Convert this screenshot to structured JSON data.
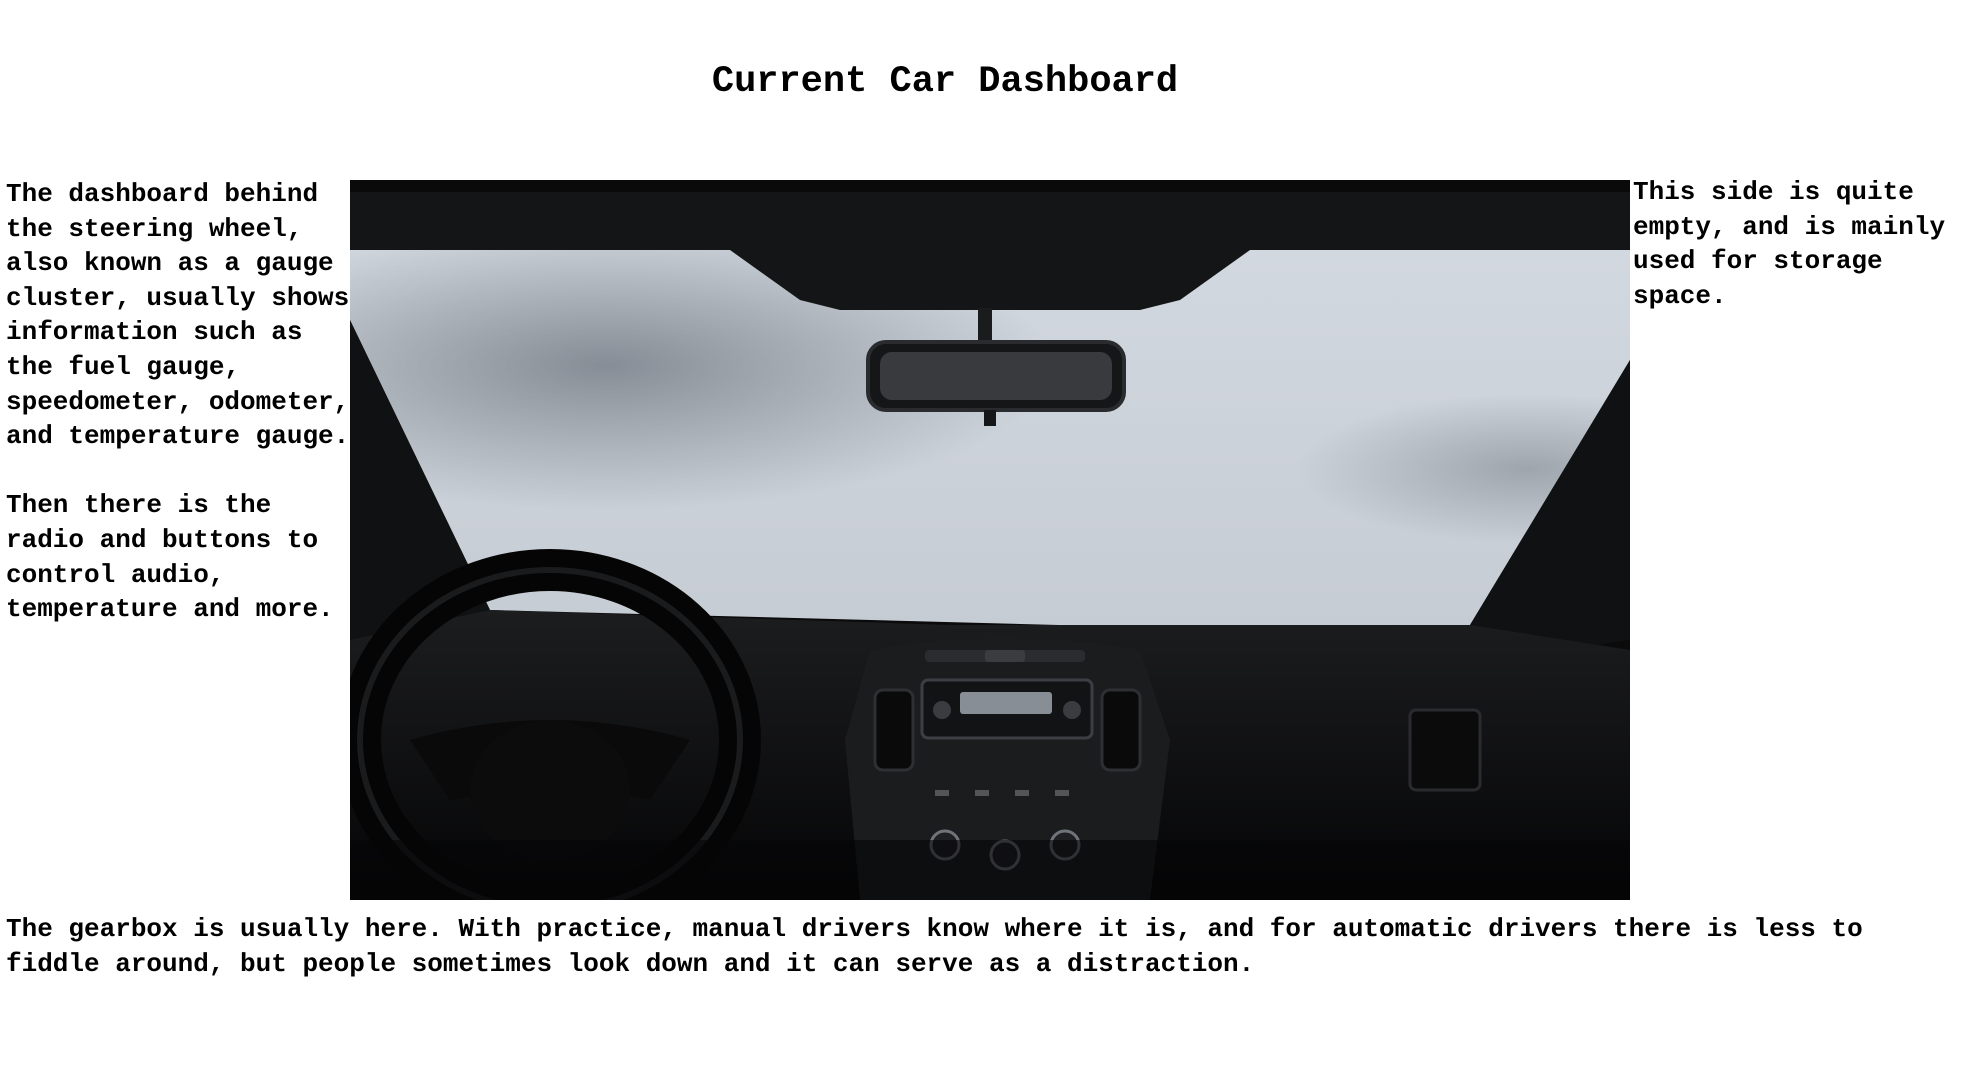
{
  "page": {
    "title": "Current Car Dashboard"
  },
  "notes": {
    "left": "The dashboard behind the steering wheel, also known as a gauge cluster, usually shows information such as the fuel gauge, speedometer, odometer, and temperature gauge.\n\nThen there is the radio and buttons to control audio, temperature and more.",
    "right": "This side is quite empty, and is mainly used for storage space.",
    "bottom": "The gearbox is usually here. With practice, manual drivers know where it is, and for automatic drivers there is less to fiddle around, but people sometimes look down and it can serve as a distraction."
  },
  "photo": {
    "subject": "car-interior-dashboard",
    "colors": {
      "interior": "#0b0b0c",
      "windshield": "#cfd5dc",
      "frost": "#8e969f"
    }
  }
}
